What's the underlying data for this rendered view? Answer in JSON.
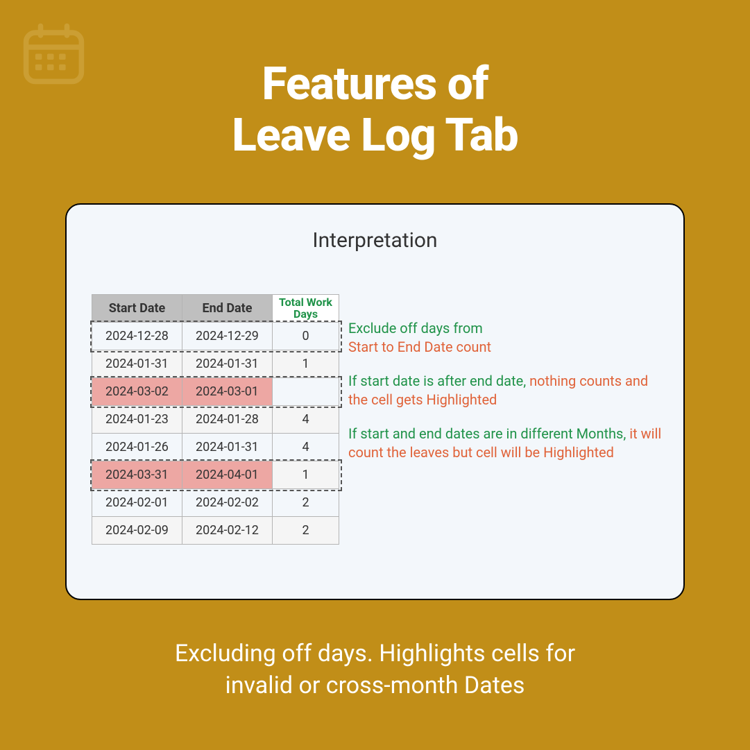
{
  "title_line1": "Features of",
  "title_line2": "Leave Log Tab",
  "panel_title": "Interpretation",
  "table": {
    "headers": {
      "start": "Start Date",
      "end": "End Date",
      "twd_l1": "Total Work",
      "twd_l2": "Days"
    },
    "rows": [
      {
        "start": "2024-12-28",
        "end": "2024-12-29",
        "twd": "0",
        "alt": false,
        "hl": false,
        "dash": true
      },
      {
        "start": "2024-01-31",
        "end": "2024-01-31",
        "twd": "1",
        "alt": true,
        "hl": false,
        "dash": false
      },
      {
        "start": "2024-03-02",
        "end": "2024-03-01",
        "twd": "",
        "alt": false,
        "hl": true,
        "dash": true
      },
      {
        "start": "2024-01-23",
        "end": "2024-01-28",
        "twd": "4",
        "alt": true,
        "hl": false,
        "dash": false
      },
      {
        "start": "2024-01-26",
        "end": "2024-01-31",
        "twd": "4",
        "alt": false,
        "hl": false,
        "dash": false
      },
      {
        "start": "2024-03-31",
        "end": "2024-04-01",
        "twd": "1",
        "alt": true,
        "hl": true,
        "dash": true
      },
      {
        "start": "2024-02-01",
        "end": "2024-02-02",
        "twd": "2",
        "alt": false,
        "hl": false,
        "dash": false
      },
      {
        "start": "2024-02-09",
        "end": "2024-02-12",
        "twd": "2",
        "alt": true,
        "hl": false,
        "dash": false
      }
    ]
  },
  "notes": {
    "n1a": "Exclude off days from",
    "n1b": "Start to End Date count",
    "n2a": "If start date is after end date, ",
    "n2b": "nothing counts and the cell gets Highlighted",
    "n3a": "If start and end dates are in different Months, ",
    "n3b": "it will count the leaves but cell will be Highlighted"
  },
  "footer_l1": "Excluding off days. Highlights cells for",
  "footer_l2": "invalid or cross-month Dates"
}
